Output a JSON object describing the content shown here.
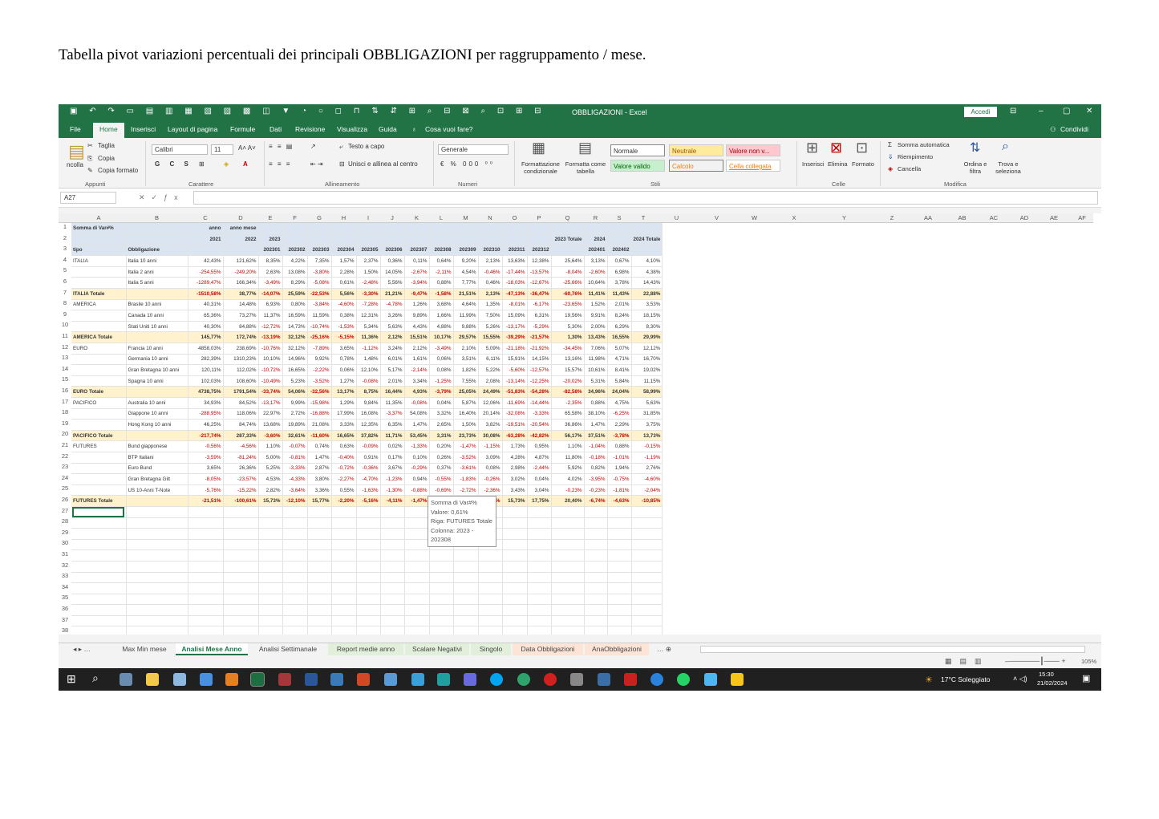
{
  "caption": "Tabella pivot variazioni percentuali dei principali OBBLIGAZIONI per raggruppamento / mese.",
  "window": {
    "title": "OBBLIGAZIONI - Excel",
    "signin": "Accedi"
  },
  "menu": [
    "File",
    "Home",
    "Inserisci",
    "Layout di pagina",
    "Formule",
    "Dati",
    "Revisione",
    "Visualizza",
    "Guida",
    "Cosa vuoi fare?",
    "Condividi"
  ],
  "ribbon": {
    "clipboard": {
      "paste": "ncolla",
      "cut": "Taglia",
      "copy": "Copia",
      "format": "Copia formato",
      "group": "Appunti"
    },
    "font": {
      "name": "Calibri",
      "size": "11",
      "group": "Carattere"
    },
    "align": {
      "wrap": "Testo a capo",
      "merge": "Unisci e allinea al centro",
      "group": "Allineamento"
    },
    "number": {
      "format": "Generale",
      "group": "Numeri"
    },
    "styles": {
      "cond": "Formattazione condizionale",
      "table": "Formatta come tabella",
      "normale": "Normale",
      "neutrale": "Neutrale",
      "valore_non": "Valore non v...",
      "valore_valido": "Valore valido",
      "calcolo": "Calcolo",
      "cella": "Cella collegata",
      "group": "Stili"
    },
    "cells": {
      "insert": "Inserisci",
      "delete": "Elimina",
      "format": "Formato",
      "group": "Celle"
    },
    "edit": {
      "autosum": "Somma automatica",
      "fill": "Riempimento",
      "clear": "Cancella",
      "sort": "Ordina e filtra",
      "find": "Trova e seleziona",
      "group": "Modifica"
    }
  },
  "namebox": "A27",
  "columns": [
    "A",
    "B",
    "C",
    "D",
    "E",
    "F",
    "G",
    "H",
    "I",
    "J",
    "K",
    "L",
    "M",
    "N",
    "O",
    "P",
    "Q",
    "R",
    "S",
    "T",
    "U",
    "V",
    "W",
    "X",
    "Y",
    "Z",
    "AA",
    "AB",
    "AC",
    "AD",
    "AE",
    "AF"
  ],
  "rows": [
    "1",
    "2",
    "3",
    "4",
    "5",
    "6",
    "7",
    "8",
    "9",
    "10",
    "11",
    "12",
    "13",
    "14",
    "15",
    "16",
    "17",
    "18",
    "19",
    "20",
    "21",
    "22",
    "23",
    "24",
    "25",
    "26",
    "27",
    "28",
    "29",
    "30",
    "31",
    "32",
    "33",
    "34",
    "35",
    "36",
    "37",
    "38"
  ],
  "pivot": {
    "row1": [
      "Somma di Var#%",
      "",
      "anno",
      "anno mese"
    ],
    "row2": [
      "",
      "",
      "2021",
      "2022",
      "2023",
      "",
      "",
      "",
      "",
      "",
      "",
      "",
      "",
      "",
      "",
      "",
      "2023 Totale",
      "2024",
      "",
      "2024 Totale"
    ],
    "row3": [
      "tipo",
      "Obbligazione",
      "",
      "",
      "202301",
      "202302",
      "202303",
      "202304",
      "202305",
      "202306",
      "202307",
      "202308",
      "202309",
      "202310",
      "202311",
      "202312",
      "",
      "202401",
      "202402",
      ""
    ],
    "data": [
      [
        "ITALIA",
        "Italia 10 anni",
        "42,43%",
        "121,62%",
        "8,35%",
        "4,22%",
        "7,35%",
        "1,57%",
        "2,37%",
        "0,36%",
        "0,11%",
        "0,64%",
        "9,20%",
        "2,13%",
        "13,63%",
        "12,38%",
        "25,64%",
        "3,13%",
        "0,67%",
        "4,10%"
      ],
      [
        "",
        "Italia 2 anni",
        "-254,55%",
        "-249,20%",
        "2,63%",
        "13,08%",
        "-3,80%",
        "2,28%",
        "1,50%",
        "14,05%",
        "-2,67%",
        "-2,11%",
        "4,54%",
        "-0,46%",
        "-17,44%",
        "-13,57%",
        "-8,04%",
        "-2,60%",
        "6,98%",
        "4,38%"
      ],
      [
        "",
        "Italia 5 anni",
        "-1289,47%",
        "166,34%",
        "-3,49%",
        "8,29%",
        "-5,08%",
        "0,61%",
        "-2,48%",
        "5,56%",
        "-3,94%",
        "0,88%",
        "7,77%",
        "0,46%",
        "-18,03%",
        "-12,67%",
        "-25,66%",
        "10,64%",
        "3,78%",
        "14,43%"
      ],
      [
        "ITALIA Totale",
        "",
        "-1510,58%",
        "38,77%",
        "-14,07%",
        "25,59%",
        "-22,53%",
        "5,56%",
        "-3,30%",
        "21,21%",
        "-9,47%",
        "-1,58%",
        "21,51%",
        "2,13%",
        "-47,13%",
        "-36,47%",
        "-60,76%",
        "11,41%",
        "11,43%",
        "22,88%"
      ],
      [
        "AMERICA",
        "Brasile 10 anni",
        "40,31%",
        "14,48%",
        "6,93%",
        "0,80%",
        "-3,84%",
        "-4,60%",
        "-7,28%",
        "-4,78%",
        "1,26%",
        "3,68%",
        "4,64%",
        "1,35%",
        "-8,01%",
        "-6,17%",
        "-23,65%",
        "1,52%",
        "2,01%",
        "3,53%"
      ],
      [
        "",
        "Canada 10 anni",
        "65,36%",
        "73,27%",
        "11,37%",
        "16,59%",
        "11,59%",
        "0,38%",
        "12,31%",
        "3,26%",
        "9,89%",
        "1,66%",
        "11,99%",
        "7,50%",
        "15,09%",
        "6,31%",
        "19,56%",
        "9,91%",
        "8,24%",
        "18,15%"
      ],
      [
        "",
        "Stati Uniti 10 anni",
        "40,30%",
        "84,88%",
        "-12,72%",
        "14,73%",
        "-10,74%",
        "-1,53%",
        "5,34%",
        "5,63%",
        "4,43%",
        "4,88%",
        "9,88%",
        "5,26%",
        "-13,17%",
        "-5,29%",
        "5,30%",
        "2,00%",
        "6,29%",
        "8,30%"
      ],
      [
        "AMERICA Totale",
        "",
        "145,77%",
        "172,74%",
        "-13,19%",
        "32,12%",
        "-25,16%",
        "-5,15%",
        "11,36%",
        "2,12%",
        "15,51%",
        "10,17%",
        "29,57%",
        "15,55%",
        "-39,29%",
        "-21,57%",
        "1,30%",
        "13,43%",
        "16,55%",
        "29,99%"
      ],
      [
        "EURO",
        "Francia 10 anni",
        "4858,03%",
        "238,69%",
        "-10,76%",
        "32,12%",
        "-7,89%",
        "3,65%",
        "-1,12%",
        "3,24%",
        "2,12%",
        "-3,49%",
        "2,10%",
        "5,09%",
        "-21,18%",
        "-21,92%",
        "-34,45%",
        "7,06%",
        "5,07%",
        "12,12%"
      ],
      [
        "",
        "Germania 10 anni",
        "282,39%",
        "1310,23%",
        "10,10%",
        "14,96%",
        "9,92%",
        "0,78%",
        "1,48%",
        "6,01%",
        "1,61%",
        "0,06%",
        "3,51%",
        "6,11%",
        "15,91%",
        "14,15%",
        "13,16%",
        "11,98%",
        "4,71%",
        "16,70%"
      ],
      [
        "",
        "Gran Bretagna 10 anni",
        "120,11%",
        "112,02%",
        "-10,72%",
        "16,65%",
        "-2,22%",
        "0,06%",
        "12,10%",
        "5,17%",
        "-2,14%",
        "0,08%",
        "1,82%",
        "5,22%",
        "-5,60%",
        "-12,57%",
        "15,57%",
        "10,61%",
        "8,41%",
        "19,02%"
      ],
      [
        "",
        "Spagna 10 anni",
        "102,03%",
        "108,60%",
        "-10,49%",
        "5,23%",
        "-3,52%",
        "1,27%",
        "-0,08%",
        "2,01%",
        "3,34%",
        "-1,25%",
        "7,55%",
        "2,08%",
        "-13,14%",
        "-12,25%",
        "-20,02%",
        "5,31%",
        "5,84%",
        "11,15%"
      ],
      [
        "EURO Totale",
        "",
        "4738,75%",
        "1791,54%",
        "-33,74%",
        "54,06%",
        "-32,56%",
        "13,17%",
        "8,75%",
        "16,44%",
        "4,93%",
        "-3,79%",
        "25,05%",
        "24,49%",
        "-51,83%",
        "-54,28%",
        "-82,58%",
        "34,96%",
        "24,04%",
        "58,99%"
      ],
      [
        "PACIFICO",
        "Australia 10 anni",
        "34,93%",
        "84,52%",
        "-13,17%",
        "9,99%",
        "-15,98%",
        "1,29%",
        "9,84%",
        "11,35%",
        "-0,08%",
        "0,04%",
        "5,87%",
        "12,06%",
        "-11,69%",
        "-14,44%",
        "-2,35%",
        "0,88%",
        "4,75%",
        "5,63%"
      ],
      [
        "",
        "Giappone 10 anni",
        "-288,95%",
        "118,06%",
        "22,97%",
        "2,72%",
        "-16,88%",
        "17,99%",
        "16,08%",
        "-3,37%",
        "54,08%",
        "3,32%",
        "16,40%",
        "20,14%",
        "-32,08%",
        "-3,33%",
        "65,58%",
        "38,10%",
        "-6,25%",
        "31,85%"
      ],
      [
        "",
        "Hong Kong 10 anni",
        "46,25%",
        "84,74%",
        "13,68%",
        "19,89%",
        "21,08%",
        "3,33%",
        "12,35%",
        "6,35%",
        "1,47%",
        "2,65%",
        "1,50%",
        "3,82%",
        "-19,51%",
        "-20,54%",
        "36,86%",
        "1,47%",
        "2,29%",
        "3,75%"
      ],
      [
        "PACIFICO Totale",
        "",
        "-217,74%",
        "287,33%",
        "-3,60%",
        "32,61%",
        "-11,60%",
        "16,65%",
        "37,82%",
        "11,71%",
        "53,45%",
        "3,31%",
        "23,73%",
        "30,08%",
        "-63,28%",
        "-42,82%",
        "56,17%",
        "37,51%",
        "-3,78%",
        "13,73%"
      ],
      [
        "FUTURES",
        "Bund giapponese",
        "-0,56%",
        "-4,56%",
        "1,10%",
        "-0,07%",
        "0,74%",
        "0,63%",
        "-0,09%",
        "0,02%",
        "-1,33%",
        "0,20%",
        "-1,47%",
        "-1,15%",
        "1,73%",
        "0,95%",
        "1,10%",
        "-1,04%",
        "0,88%",
        "-0,15%"
      ],
      [
        "",
        "BTP Italiani",
        "-3,59%",
        "-81,24%",
        "5,00%",
        "-0,81%",
        "1,47%",
        "-0,40%",
        "0,91%",
        "0,17%",
        "0,10%",
        "0,26%",
        "-3,52%",
        "3,09%",
        "4,28%",
        "4,87%",
        "11,80%",
        "-0,18%",
        "-1,01%",
        "-1,19%"
      ],
      [
        "",
        "Euro Bund",
        "3,65%",
        "26,36%",
        "5,25%",
        "-3,33%",
        "2,87%",
        "-0,72%",
        "-0,36%",
        "3,67%",
        "-0,29%",
        "0,37%",
        "-3,61%",
        "0,08%",
        "2,98%",
        "-2,44%",
        "5,92%",
        "0,82%",
        "1,94%",
        "2,76%"
      ],
      [
        "",
        "Gran Bretagna Gilt",
        "-8,05%",
        "-23,57%",
        "4,53%",
        "-4,33%",
        "3,80%",
        "-2,27%",
        "-4,70%",
        "-1,23%",
        "0,94%",
        "-0,55%",
        "-1,83%",
        "-0,26%",
        "3,02%",
        "0,04%",
        "4,02%",
        "-3,95%",
        "-0,75%",
        "-4,60%"
      ],
      [
        "",
        "US 10-Anni T-Note",
        "-5,76%",
        "-15,22%",
        "2,82%",
        "-3,64%",
        "3,36%",
        "0,55%",
        "-1,63%",
        "-1,30%",
        "-0,88%",
        "-0,69%",
        "-2,72%",
        "-2,36%",
        "3,43%",
        "3,04%",
        "-0,23%",
        "-0,23%",
        "-1,81%",
        "-2,04%"
      ],
      [
        "FUTURES Totale",
        "",
        "-21,51%",
        "-100,61%",
        "15,73%",
        "-12,10%",
        "15,77%",
        "-2,20%",
        "-5,16%",
        "-4,11%",
        "-1,47%",
        "0,61%",
        "-10,27%",
        "-0,85%",
        "15,73%",
        "17,75%",
        "20,40%",
        "-6,74%",
        "-4,63%",
        "-10,85%"
      ]
    ]
  },
  "tooltip": {
    "l1": "Somma di Var#%",
    "l2": "Valore: 0,61%",
    "l3": "Riga: FUTURES Totale",
    "l4": "Colonna: 2023 - 202308"
  },
  "tabs": [
    "Max Min mese",
    "Analisi Mese Anno",
    "Analisi Settimanale",
    "Report medie anno",
    "Scalare Negativi",
    "Singolo",
    "Data Obbligazioni",
    "AnaObbligazioni"
  ],
  "status": {
    "zoom": "105%"
  },
  "taskbar": {
    "weather": "17°C Soleggiato",
    "time": "15:30",
    "date": "21/02/2024"
  },
  "colors": {
    "excel_green": "#217346",
    "negative": "#c00000",
    "total_row": "#fff2cc"
  }
}
